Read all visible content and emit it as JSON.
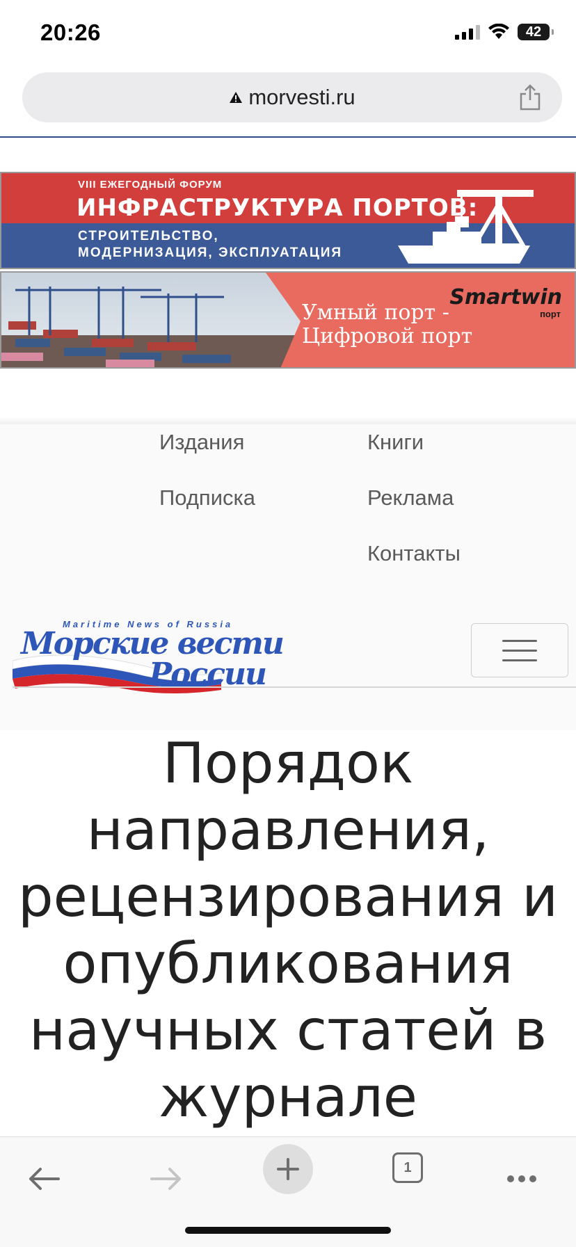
{
  "status_bar": {
    "time": "20:26",
    "battery": "42"
  },
  "browser": {
    "url": "morvesti.ru",
    "tabs_count": "1"
  },
  "banner1": {
    "small": "VIII ЕЖЕГОДНЫЙ ФОРУМ",
    "title": "ИНФРАСТРУКТУРА ПОРТОВ:",
    "subtitle_line1": "СТРОИТЕЛЬСТВО,",
    "subtitle_line2": "МОДЕРНИЗАЦИЯ, ЭКСПЛУАТАЦИЯ",
    "colors": {
      "red": "#d23e3c",
      "blue": "#3d5a98"
    }
  },
  "banner2": {
    "line1": "Умный порт -",
    "line2": "Цифровой порт",
    "brand": "Smartwin",
    "brand_sub": "порт",
    "color": "#e96a5e"
  },
  "menu": {
    "items": [
      "Издания",
      "Книги",
      "Подписка",
      "Реклама",
      "Контакты"
    ]
  },
  "logo": {
    "top_text": "Maritime News of Russia",
    "line1": "Морские вести",
    "line2": "России"
  },
  "page": {
    "title": "Порядок направления, рецензирования и опубликования научных статей в журнале"
  }
}
